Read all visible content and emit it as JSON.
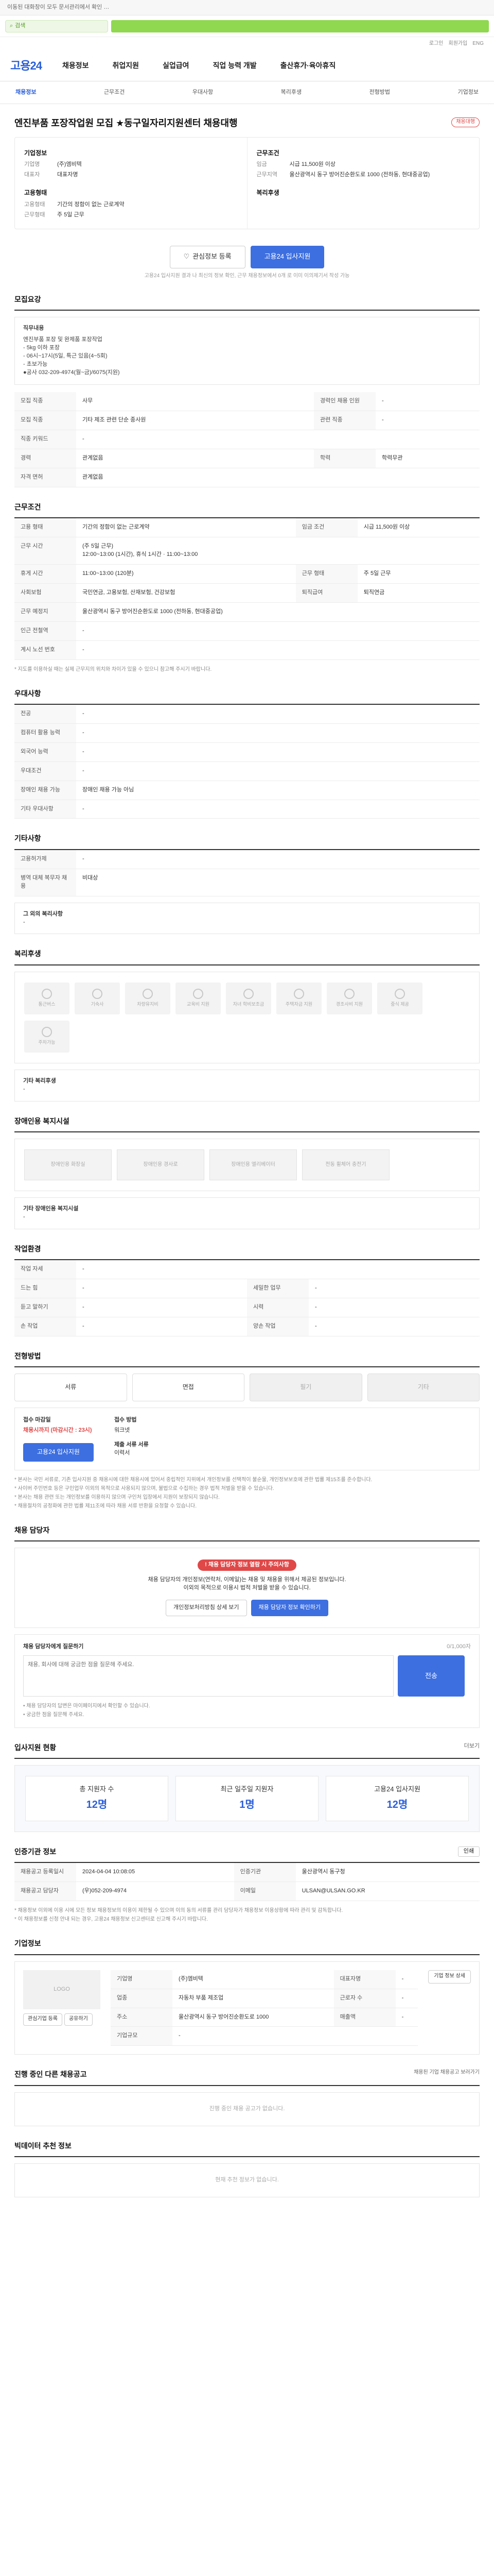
{
  "topbar": {
    "notice": "이동된 대화창이 모두 문서관리에서 확인 …"
  },
  "search": {
    "placeholder": "검색"
  },
  "utility": {
    "links": [
      "로그인",
      "회원가입",
      "ENG"
    ]
  },
  "gnb": {
    "logo": "고용24",
    "menu": [
      "채용정보",
      "취업지원",
      "실업급여",
      "직업 능력 개발",
      "출산휴가·육아휴직"
    ]
  },
  "lnb": {
    "items": [
      "채용정보",
      "근무조건",
      "우대사항",
      "복리후생",
      "전형방법",
      "기업정보"
    ]
  },
  "job": {
    "title": "엔진부품 포장작업원 모집 ★동구일자리지원센터 채용대행",
    "badge": "채용대행",
    "company_label": "기업정보",
    "company_name_k": "기업명",
    "company_name": "(주)엠비텍",
    "ceo_k": "대표자",
    "ceo": "대표자명",
    "cond_label": "고용형태",
    "employ_k": "고용형태",
    "employ": "기간의 정함이 없는 근로계약",
    "work_k": "근무형태",
    "work": "주 5일 근무",
    "wage_label": "근무조건",
    "wage_k": "임금",
    "wage": "시급 11,500원 이상",
    "loc_k": "근무지역",
    "loc": "울산광역시 동구 방어진순환도로 1000 (전하동, 현대중공업)",
    "benefit_label": "복리후생"
  },
  "buttons": {
    "scrap": "관심정보 등록",
    "apply": "고용24 입사지원"
  },
  "note_apply": "고용24 입사지원 결과 나 최신의 정보 확인, 근무 채용정보에서 0개 로 이미 이의제기서 작성 가능",
  "recruit": {
    "title": "모집요강",
    "box_title": "직무내용",
    "box_lines": [
      "엔진부품 포장 및 완제품 포장작업",
      "- 5kg 이하 포장",
      "- 06시~17시(5일, 특근 있음(4~5회)",
      "- 초보가능",
      "●공사 032-209-4974(월~금)/6075(지원)"
    ]
  },
  "recruit_table": [
    [
      "모집 직종",
      "사무",
      "경력인 채용 인원",
      "-"
    ],
    [
      "모집 직종",
      "기타 제조 관련 단순 종사원",
      "관련 직종",
      "-"
    ],
    [
      "직종 키워드",
      "-",
      "",
      ""
    ],
    [
      "경력",
      "관계없음",
      "학력",
      "학력무관"
    ],
    [
      "자격 면허",
      "관계없음",
      "",
      ""
    ]
  ],
  "conditions": {
    "title": "근무조건",
    "rows": [
      [
        "고용 형태",
        "기간의 정함이 없는 근로계약",
        "임금 조건",
        "시급 11,500원 이상"
      ],
      [
        "근무 시간",
        "(주 5일 근무)\n12:00~13:00 (1시간), 휴식 1시간 · 11:00~13:00",
        "",
        ""
      ],
      [
        "휴게 시간",
        "11:00~13:00 (120분)",
        "근무 형태",
        "주 5일 근무"
      ],
      [
        "사회보험",
        "국민연금, 고용보험, 산재보험, 건강보험",
        "퇴직급여",
        "퇴직연금"
      ],
      [
        "근무 예정지",
        "울산광역시 동구 방어진순환도로 1000 (전하동, 현대중공업)",
        "",
        ""
      ],
      [
        "인근 전철역",
        "-",
        "",
        ""
      ],
      [
        "계시 노선 번호",
        "-",
        "",
        ""
      ]
    ],
    "footnote": "* 지도를 이용하실 때는 실제 근무지의 위치와 차이가 있을 수 있으니 참고해 주시기 바랍니다."
  },
  "preference": {
    "title": "우대사항",
    "rows": [
      [
        "전공",
        "-"
      ],
      [
        "컴퓨터 활용 능력",
        "-"
      ],
      [
        "외국어 능력",
        "-"
      ],
      [
        "우대조건",
        "-"
      ],
      [
        "장애인 채용 가능",
        "장애인 채용 가능 아님"
      ],
      [
        "기타 우대사항",
        "-"
      ]
    ]
  },
  "other": {
    "title": "기타사항",
    "rows": [
      [
        "고용허가제",
        "-"
      ],
      [
        "병역 대체 복무자 채용",
        "비대상"
      ]
    ],
    "extra_title": "그 외의 복리사항",
    "extra_value": "-"
  },
  "welfare": {
    "title": "복리후생",
    "tiles": [
      "통근버스",
      "기숙사",
      "차량유지비",
      "교육비 지원",
      "자녀 학비보조금",
      "주택자금 지원",
      "경조사비 지원",
      "중식 제공",
      "주차가능"
    ],
    "extra_title": "기타 복리후생",
    "extra_value": "-"
  },
  "disability": {
    "title": "장애인용 복지시설",
    "tiles": [
      "장애인용 화장실",
      "장애인용 경사로",
      "장애인용 엘리베이터",
      "전동 휠체어 충전기"
    ],
    "extra_title": "기타 장애인용 복지시설",
    "extra_value": "-"
  },
  "env": {
    "title": "작업환경",
    "rows": [
      [
        "작업 자세",
        "-",
        "",
        ""
      ],
      [
        "드는 힘",
        "-",
        "세밀한 업무",
        "-"
      ],
      [
        "듣고 말하기",
        "-",
        "시력",
        "-"
      ],
      [
        "손 작업",
        "-",
        "양손 작업",
        "-"
      ]
    ]
  },
  "selection": {
    "title": "전형방법",
    "methods": [
      {
        "label": "서류",
        "enabled": true
      },
      {
        "label": "면접",
        "enabled": true
      },
      {
        "label": "필기",
        "enabled": false
      },
      {
        "label": "기타",
        "enabled": false
      }
    ],
    "deadline_label": "접수 마감일",
    "deadline": "채용시까지 (마감시간 : 23시)",
    "method_label": "접수 방법",
    "method_value": "워크넷",
    "docs_label": "제출 서류 서류",
    "docs_value": "이력서",
    "apply_button": "고용24 입사지원",
    "notes": [
      "* 본사는 국민 서류로, 기존 입사지원 중 채용시에 대한 채용시에 있어서 중립적인 지위에서 개인정보를 선택적이 불순물, 개인정보보호에 관한 법률 제15조를 준수합니다.",
      "* 사이버 주민번호 등은 구인업무 이외의 목적으로 사용되지 않으며, 불법으로 수집하는 경우 법적 처벌을 받을 수 있습니다.",
      "* 본사는 채용 관련 또는 개인정보를 이용하지 않으며 구인처 입장에서 지원이 보장되지 않습니다.",
      "* 채용절차의 공정화에 관한 법률 제11조에 따라 채용 서류 반환을 요청할 수 있습니다."
    ]
  },
  "contact": {
    "title": "채용 담당자",
    "warn": "채용 담당자 정보 열람 시 주의사항",
    "text1": "채용 담당자의 개인정보(연락처, 이메일)는 채용 및 채용을 위해서 제공된 정보입니다.",
    "text2": "이외의 목적으로 이용시 법적 처벌을 받을 수 있습니다.",
    "btn_outline": "개인정보처리방침 상세 보기",
    "btn_primary": "채용 담당자 정보 확인하기"
  },
  "inquiry": {
    "title": "채용 담당자에게 질문하기",
    "counter": "0/1,000자",
    "placeholder": "채용, 회사에 대해 궁금한 점을 질문해 주세요.",
    "submit": "전송",
    "notes": [
      "• 채용 담당자의 답변은 마이페이지에서 확인할 수 있습니다.",
      "• 궁금한 점을 질문해 주세요."
    ]
  },
  "stats": {
    "title": "입사지원 현황",
    "more": "더보기",
    "items": [
      {
        "label": "총 지원자 수",
        "value": "12명"
      },
      {
        "label": "최근 일주일 지원자",
        "value": "1명"
      },
      {
        "label": "고용24 입사지원",
        "value": "12명"
      }
    ]
  },
  "recruiter": {
    "title": "인증기관 정보",
    "print": "인쇄",
    "rows": [
      [
        "채용공고 등록일시",
        "2024-04-04 10:08:05",
        "인증기관",
        "울산광역시 동구청"
      ],
      [
        "채용공고 담당자",
        "(우)052-209-4974",
        "이메일",
        "ULSAN@ULSAN.GO.KR"
      ]
    ],
    "notes": [
      "* 채용정보 이외에 이용 시에 모든 정보 채용정보의 이용이 제한될 수 있으며 이의 동의 서류를 관리 담당자가 채용정보 이용상황에 따라 관리 및 감독합니다.",
      "* 이 채용정보를 신청 안내 되는 경우, 고용24 채용정보 신고센터로 신고해 주시기 바랍니다."
    ]
  },
  "company": {
    "title": "기업정보",
    "logo": "LOGO",
    "detail_btn": "기업 정보 상세",
    "rows": [
      [
        "기업명",
        "(주)엠비텍",
        "대표자명",
        "-"
      ],
      [
        "업종",
        "자동차 부품 제조업",
        "근로자 수",
        "-"
      ],
      [
        "주소",
        "울산광역시 동구 방어진순환도로 1000",
        "매출액",
        "-"
      ],
      [
        "기업규모",
        "-",
        "",
        ""
      ]
    ],
    "buttons": [
      "관심기업 등록",
      "공유하기"
    ]
  },
  "others": {
    "title": "진행 중인 다른 채용공고",
    "more": "채용된 기업 채용공고 보러가기",
    "empty": "진행 중인 채용 공고가 없습니다."
  },
  "recommend": {
    "title": "빅데이터 추천 정보",
    "empty": "현재 추천 정보가 없습니다."
  }
}
